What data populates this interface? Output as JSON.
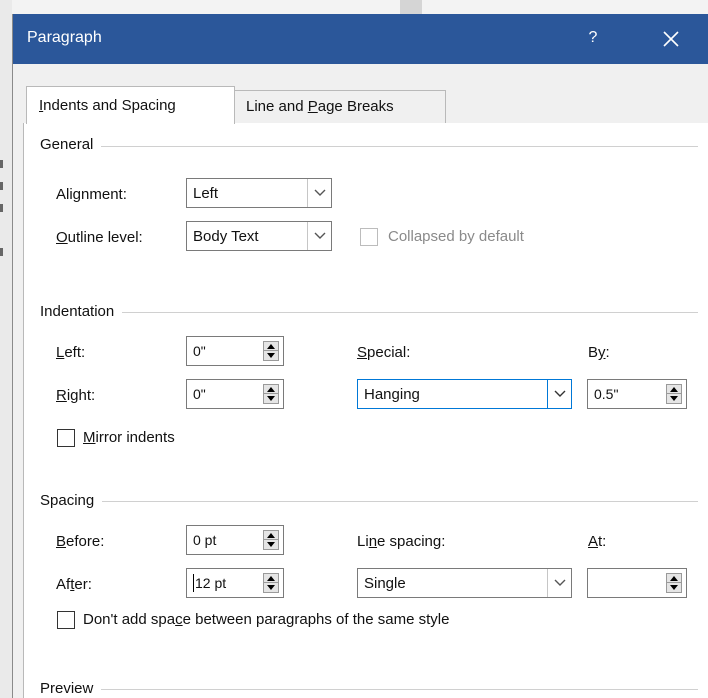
{
  "window": {
    "title": "Paragraph",
    "help_label": "?",
    "close_icon": "close-icon"
  },
  "tabs": [
    {
      "label_pre": "",
      "label_key": "I",
      "label_post": "ndents and Spacing",
      "active": true
    },
    {
      "label_pre": "Line and ",
      "label_key": "P",
      "label_post": "age Breaks",
      "active": false
    }
  ],
  "general": {
    "section_title": "General",
    "alignment": {
      "label_pre": "Ali",
      "label_key": "g",
      "label_post": "nment:",
      "value": "Left"
    },
    "outline_level": {
      "label_pre": "",
      "label_key": "O",
      "label_post": "utline level:",
      "value": "Body Text"
    },
    "collapsed": {
      "label": "Collapsed by default",
      "checked": false,
      "enabled": false
    }
  },
  "indentation": {
    "section_title": "Indentation",
    "left": {
      "label_pre": "",
      "label_key": "L",
      "label_post": "eft:",
      "value": "0\""
    },
    "right": {
      "label_pre": "",
      "label_key": "R",
      "label_post": "ight:",
      "value": "0\""
    },
    "special": {
      "label_pre": "",
      "label_key": "S",
      "label_post": "pecial:",
      "value": "Hanging"
    },
    "by": {
      "label_pre": "B",
      "label_key": "y",
      "label_post": ":",
      "value": "0.5\""
    },
    "mirror": {
      "label_pre": "",
      "label_key": "M",
      "label_post": "irror indents",
      "checked": false
    }
  },
  "spacing": {
    "section_title": "Spacing",
    "before": {
      "label_pre": "",
      "label_key": "B",
      "label_post": "efore:",
      "value": "0 pt"
    },
    "after": {
      "label_pre": "Af",
      "label_key": "t",
      "label_post": "er:",
      "value": "12 pt"
    },
    "line_spacing": {
      "label_pre": "Li",
      "label_key": "n",
      "label_post": "e spacing:",
      "value": "Single"
    },
    "at": {
      "label_pre": "",
      "label_key": "A",
      "label_post": "t:",
      "value": ""
    },
    "dont_add": {
      "label_pre": "Don't add spa",
      "label_key": "c",
      "label_post": "e between paragraphs of the same style",
      "checked": false
    }
  },
  "preview": {
    "section_title": "Preview"
  }
}
